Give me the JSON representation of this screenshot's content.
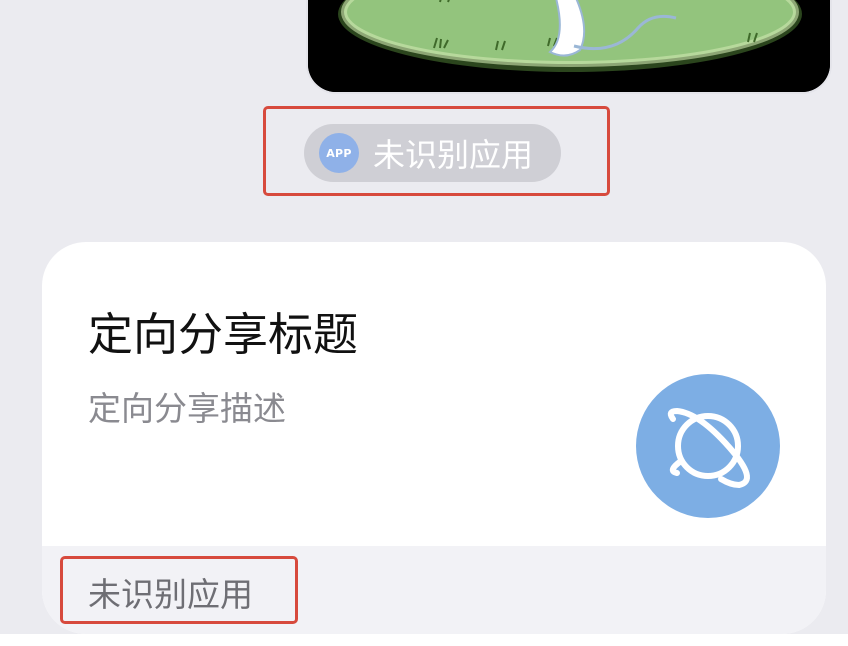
{
  "image_message": {
    "icon": "image-thumbnail-cartoon-grass"
  },
  "source_tag": {
    "icon_text": "APP",
    "label": "未识别应用"
  },
  "share_card": {
    "title": "定向分享标题",
    "description": "定向分享描述",
    "icon": "globe-icon",
    "footer_label": "未识别应用"
  },
  "colors": {
    "background": "#ebebf0",
    "annotation": "#d74a3d",
    "accent_blue": "#7daee4",
    "pill": "#cfcfd5"
  }
}
